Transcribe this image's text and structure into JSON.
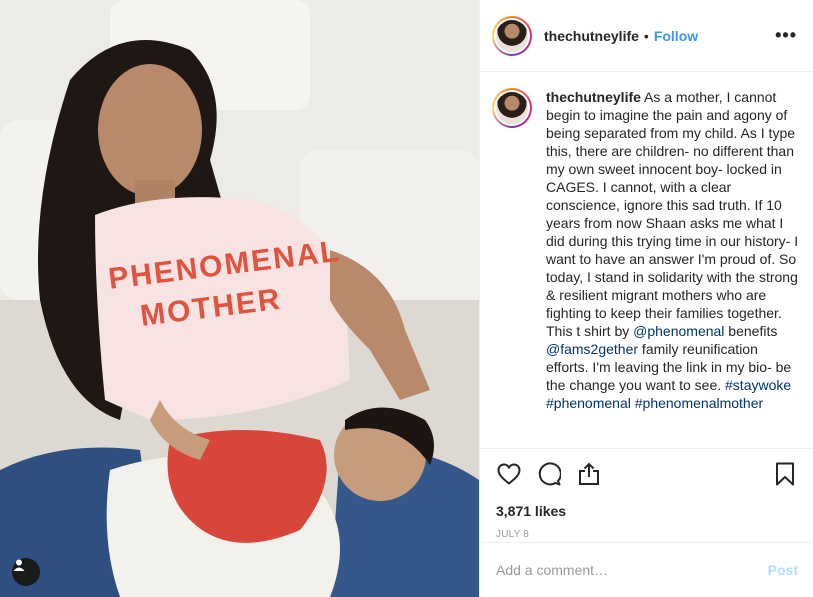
{
  "post": {
    "username": "thechutneylife",
    "dot": "•",
    "follow_label": "Follow",
    "more_label": "•••"
  },
  "photo": {
    "shirt_line1": "PHENOMENAL",
    "shirt_line2": "MOTHER"
  },
  "caption": {
    "username": "thechutneylife",
    "text_part1": " As a mother, I cannot begin to imagine the pain and agony of being separated from my child. As I type this, there are children- no different than my own sweet innocent boy- locked in CAGES. I cannot, with a clear conscience, ignore this sad truth. If 10 years from now Shaan asks me what I did during this trying time in our history- I want to have an answer I'm proud of. So today, I stand in solidarity with the strong & resilient migrant mothers who are fighting to keep their families together. This t shirt by ",
    "mention1": "@phenomenal",
    "text_part2": " benefits ",
    "mention2": "@fams2gether",
    "text_part3": " family reunification efforts. I'm leaving the link in my bio- be the change you want to see. ",
    "hashtag1": "#staywoke",
    "hashtag2": "#phenomenal",
    "hashtag3": "#phenomenalmother"
  },
  "stats": {
    "likes": "3,871 likes",
    "date": "JULY 8"
  },
  "comment": {
    "placeholder": "Add a comment…",
    "post_label": "Post"
  },
  "icons": {
    "like": "heart-icon",
    "comment": "comment-icon",
    "share": "share-icon",
    "save": "bookmark-icon",
    "tagged": "user-tag-icon"
  },
  "colors": {
    "link": "#3897f0",
    "hashtag": "#003569",
    "post_disabled": "#b2dffc",
    "shirt_print": "#e0533f"
  }
}
